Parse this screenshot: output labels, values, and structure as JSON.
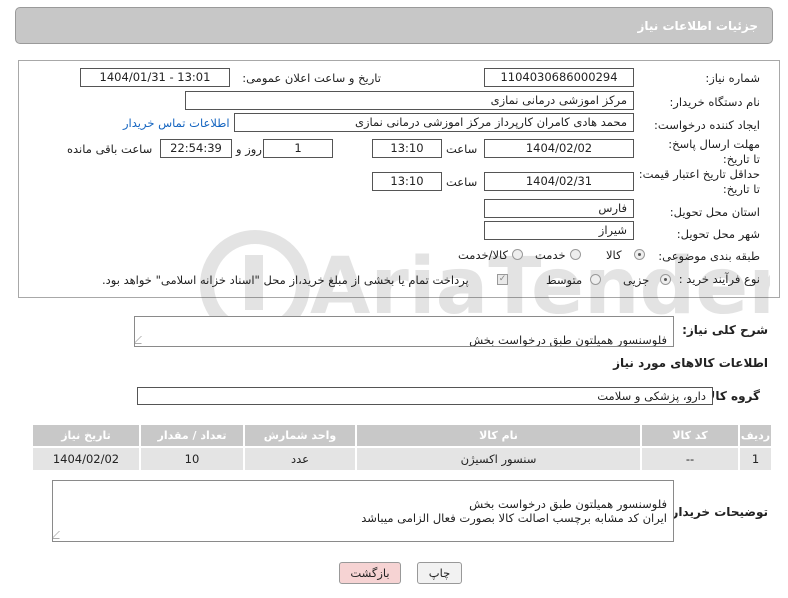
{
  "panel_title": "جزئیات اطلاعات نیاز",
  "need_number": {
    "label": "شماره نیاز:",
    "value": "1104030686000294"
  },
  "announce_datetime": {
    "label": "تاریخ و ساعت اعلان عمومی:",
    "value": "1404/01/31 - 13:01"
  },
  "buyer_org": {
    "label": "نام دستگاه خریدار:",
    "value": "مرکز اموزشی درمانی نمازی"
  },
  "requester": {
    "label": "ایجاد کننده درخواست:",
    "value": "محمد هادی کامران کارپرداز مرکز اموزشی درمانی نمازی",
    "contact_link": "اطلاعات تماس خریدار"
  },
  "reply_deadline": {
    "label": "مهلت ارسال پاسخ: تا تاریخ:",
    "date": "1404/02/02",
    "time_label": "ساعت",
    "time": "13:10",
    "days": "1",
    "days_label": "روز و",
    "remaining": "22:54:39",
    "remaining_label": "ساعت باقی مانده"
  },
  "price_validity": {
    "label": "حداقل تاریخ اعتبار قیمت: تا تاریخ:",
    "date": "1404/02/31",
    "time_label": "ساعت",
    "time": "13:10"
  },
  "delivery_province": {
    "label": "استان محل تحویل:",
    "value": "فارس"
  },
  "delivery_city": {
    "label": "شهر محل تحویل:",
    "value": "شیراز"
  },
  "category": {
    "label": "طبقه بندی موضوعی:",
    "options": [
      "کالا",
      "خدمت",
      "کالا/خدمت"
    ],
    "selected": "کالا"
  },
  "purchase_process": {
    "label": "نوع فرآیند خرید :",
    "options": [
      "جزیی",
      "متوسط"
    ],
    "selected": "جزیی",
    "payment_note": "پرداخت تمام یا بخشی از مبلغ خرید،از محل \"اسناد خزانه اسلامی\" خواهد بود."
  },
  "need_description": {
    "label": "شرح کلی نیاز:",
    "value": "فلوسنسور  همیلتون طبق درخواست بخش\nایران کد مشابه برچسب اصالت کالا بصورت فعال الزامی میباشد"
  },
  "goods_info_title": "اطلاعات کالاهای مورد نیاز",
  "goods_group": {
    "label": "گروه کالا:",
    "value": "دارو، پزشکی و سلامت"
  },
  "table": {
    "headers": [
      "ردیف",
      "کد کالا",
      "نام کالا",
      "واحد شمارش",
      "تعداد / مقدار",
      "تاریخ نیاز"
    ],
    "rows": [
      [
        "1",
        "--",
        "سنسور اکسیژن",
        "عدد",
        "10",
        "1404/02/02"
      ]
    ]
  },
  "buyer_notes": {
    "label": "توضیحات خریدار:",
    "value": "فلوسنسور  همیلتون طبق درخواست بخش\nایران کد مشابه برچسب اصالت کالا بصورت فعال الزامی میباشد"
  },
  "buttons": {
    "print": "چاپ",
    "back": "بازگشت"
  },
  "colors": {
    "panel": "#c7c7c7",
    "link": "#1565c0",
    "table_header": "#c8c8c8",
    "table_row": "#e4e4e4",
    "back_button": "#f6d3d3"
  }
}
